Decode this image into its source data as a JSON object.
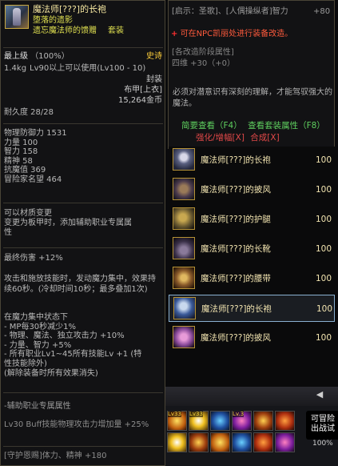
{
  "item": {
    "name": "魔法师[???]的长袍",
    "set_name": "堕落的遗影",
    "set_part": "遗忘魔法师的馈赠",
    "set_tag": "套装",
    "grade": "最上级",
    "grade_pct": "（100%）",
    "rarity": "史诗",
    "weight": "1.4kg",
    "level_req": "Lv90以上可以使用(Lv100 - 10)",
    "sealed": "封装",
    "part": "布甲[上衣]",
    "price": "15,264金币",
    "durability": "耐久度 28/28"
  },
  "stats": [
    "物理防御力 1531",
    "力量 100",
    "智力 158",
    "精神 58",
    "抗魔值 369",
    "冒险家名望 464"
  ],
  "convert": [
    "可以材质变更",
    "变更为板甲时，添加辅助职业专属属",
    "性"
  ],
  "final_damage": "最终伤害 +12%",
  "skill_desc": "攻击和施放技能时，发动魔力集中，效果持续60秒。(冷却时间10秒；最多叠加1次)",
  "buff_block": [
    "在魔力集中状态下",
    "- MP每30秒减少1%",
    "- 物理、魔法、独立攻击力 +10%",
    "- 力量、智力 +5%",
    "- 所有职业Lv1~45所有技能Lv +1 (特",
    "性技能除外)",
    "(解除装备时所有效果消失)"
  ],
  "aux": {
    "title": "-辅助职业专属属性",
    "desc": "Lv30 Buff技能物理攻击力增加量 +25%",
    "enchant": "[守护恩赐]体力、精神 +180"
  },
  "right_tooltip": {
    "top_label": "[启示：圣歌]、[人偶操纵者]智力",
    "top_value": "+80",
    "modifiable_mark": "+",
    "modifiable": "可在NPC凯丽处进行装备改造。",
    "grey_lines": [
      "[各改造阶段属性]",
      "四维 +30（+0）"
    ],
    "desc": "必须对潜意识有深刻的理解，才能驾驭强大的魔法。",
    "links_row1": [
      "简要查看（F4）",
      "查看套装属性（F8）"
    ],
    "links_row2": [
      "强化/增幅[X]",
      "合成[X]"
    ]
  },
  "equipment": [
    {
      "name": "魔法师[???]的长袍",
      "value": "100",
      "icon": "robe-icon"
    },
    {
      "name": "魔法师[???]的披风",
      "value": "100",
      "icon": "cape-icon"
    },
    {
      "name": "魔法师[???]的护腿",
      "value": "100",
      "icon": "pants-icon"
    },
    {
      "name": "魔法师[???]的长靴",
      "value": "100",
      "icon": "boots-icon"
    },
    {
      "name": "魔法师[???]的腰带",
      "value": "100",
      "icon": "belt-icon"
    },
    {
      "name": "魔法师[???]的长袍",
      "value": "100",
      "icon": "robe-icon"
    },
    {
      "name": "魔法师[???]的披风",
      "value": "100",
      "icon": "cape-icon"
    }
  ],
  "hud": {
    "arrow": "◀",
    "skill_labels": [
      "Lv33",
      "Lv33",
      "Lv.3"
    ],
    "button": "可冒险\n出战试",
    "percent": "100%"
  }
}
